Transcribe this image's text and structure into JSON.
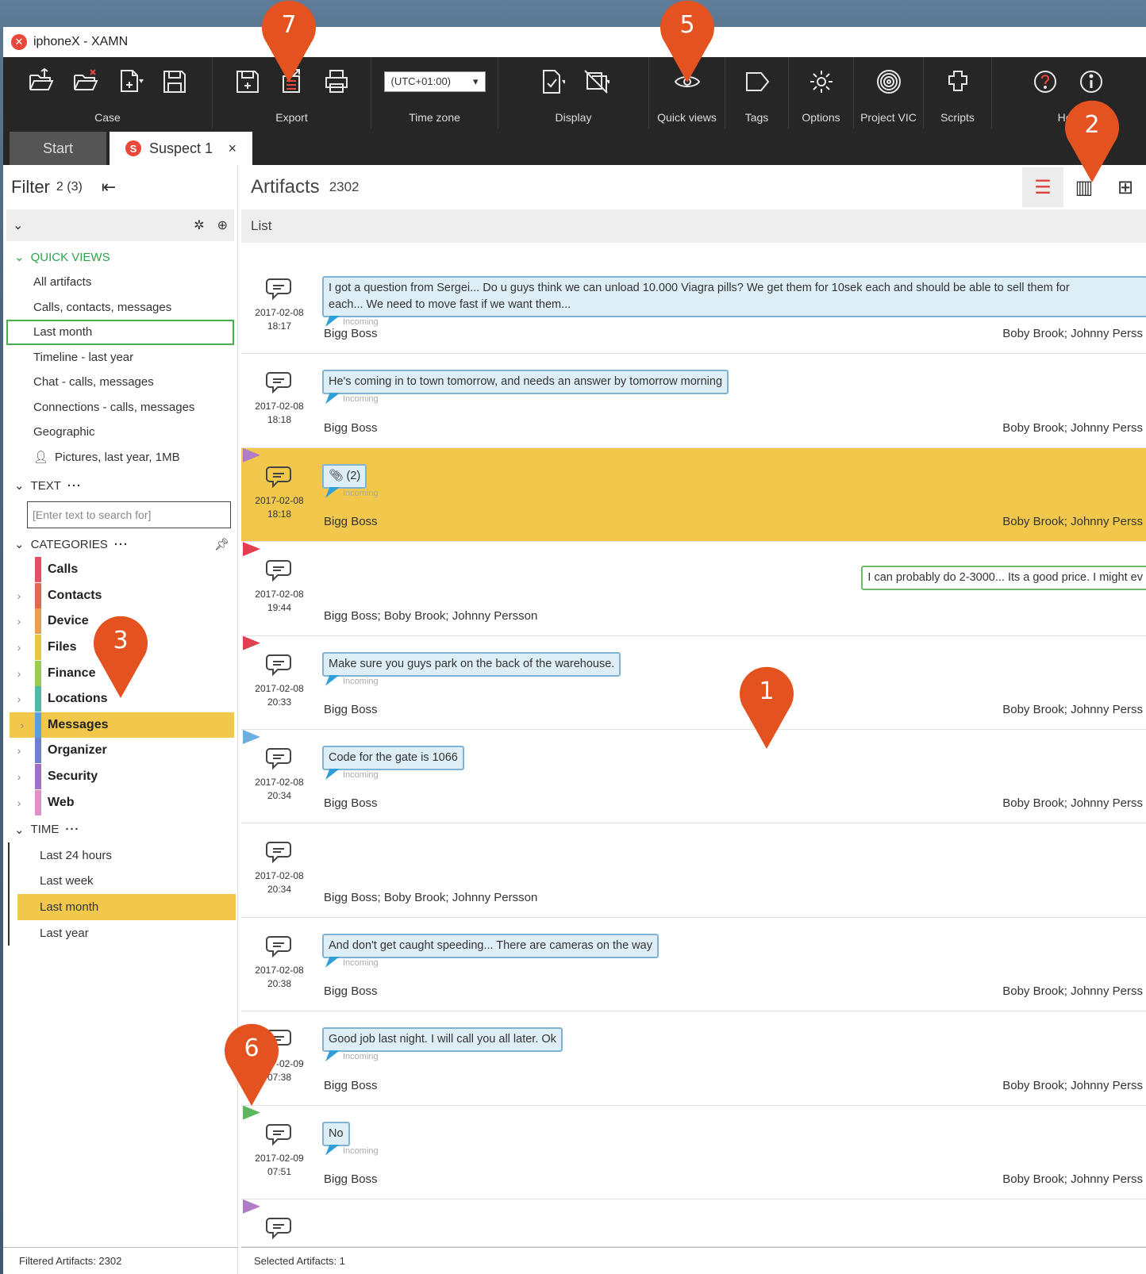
{
  "window": {
    "title": "iphoneX - XAMN",
    "logo_glyph": "✕"
  },
  "toolbar": {
    "groups": [
      {
        "label": "Case",
        "icons": [
          "open-case-icon",
          "close-case-icon",
          "new-case-icon",
          "save-icon"
        ]
      },
      {
        "label": "Export",
        "icons": [
          "save-export-icon",
          "export-icon",
          "print-icon"
        ]
      },
      {
        "label": "Time zone",
        "select_value": "(UTC+01:00)"
      },
      {
        "label": "Display",
        "icons": [
          "document-check-icon",
          "display-settings-icon"
        ]
      },
      {
        "label": "Quick views",
        "icons": [
          "eye-icon"
        ]
      },
      {
        "label": "Tags",
        "icons": [
          "tag-icon"
        ]
      },
      {
        "label": "Options",
        "icons": [
          "gear-icon"
        ]
      },
      {
        "label": "Project VIC",
        "icons": [
          "fingerprint-icon"
        ]
      },
      {
        "label": "Scripts",
        "icons": [
          "puzzle-icon"
        ]
      },
      {
        "label": "Help",
        "icons": [
          "help-icon",
          "info-icon"
        ]
      }
    ]
  },
  "tabs": {
    "start": "Start",
    "suspect": "Suspect 1",
    "suspect_badge": "S",
    "close": "×"
  },
  "filter": {
    "title": "Filter",
    "count": "2 (3)",
    "quick_views_label": "QUICK VIEWS",
    "quick_views": [
      "All artifacts",
      "Calls, contacts, messages",
      "Last month",
      "Timeline - last year",
      "Chat - calls, messages",
      "Connections - calls, messages",
      "Geographic",
      "Pictures, last year, 1MB"
    ],
    "text_label": "TEXT",
    "text_placeholder": "[Enter text to search for]",
    "categories_label": "CATEGORIES",
    "categories": [
      {
        "name": "Calls",
        "color": "#e4506a"
      },
      {
        "name": "Contacts",
        "color": "#e06850"
      },
      {
        "name": "Device",
        "color": "#e8a050"
      },
      {
        "name": "Files",
        "color": "#e8c840"
      },
      {
        "name": "Finance",
        "color": "#9acd50"
      },
      {
        "name": "Locations",
        "color": "#50b8a8"
      },
      {
        "name": "Messages",
        "color": "#5aa0e0"
      },
      {
        "name": "Organizer",
        "color": "#7080d0"
      },
      {
        "name": "Security",
        "color": "#a070c8"
      },
      {
        "name": "Web",
        "color": "#e090c8"
      }
    ],
    "time_label": "TIME",
    "time_items": [
      "Last 24 hours",
      "Last week",
      "Last month",
      "Last year"
    ],
    "footer": "Filtered Artifacts: 2302"
  },
  "artifacts": {
    "title": "Artifacts",
    "count": "2302",
    "list_label": "List",
    "footer": "Selected Artifacts: 1",
    "incoming_label": "Incoming",
    "rows": [
      {
        "date": "2017-02-08",
        "time": "18:17",
        "message": "I got a question from Sergei... Do u guys think we can unload 10.000 Viagra pills? We get them for 10sek each and should be able to sell them for",
        "message2": "each... We need to move fast if we want them...",
        "from": "Bigg Boss",
        "to": "Boby Brook; Johnny Perss",
        "flag": ""
      },
      {
        "date": "2017-02-08",
        "time": "18:18",
        "message": "He's coming in to town tomorrow, and needs an answer by tomorrow morning",
        "from": "Bigg Boss",
        "to": "Boby Brook; Johnny Perss",
        "flag": ""
      },
      {
        "date": "2017-02-08",
        "time": "18:18",
        "message": "(2)",
        "from": "Bigg Boss",
        "to": "Boby Brook; Johnny Perss",
        "flag": "#b07cc8"
      },
      {
        "date": "2017-02-08",
        "time": "19:44",
        "message": "I can probably do 2-3000... Its a good price. I might ev",
        "from": "Bigg Boss; Boby Brook; Johnny Persson",
        "to": "",
        "flag": "#e04050"
      },
      {
        "date": "2017-02-08",
        "time": "20:33",
        "message": "Make sure you guys park on the back of the warehouse.",
        "from": "Bigg Boss",
        "to": "Boby Brook; Johnny Perss",
        "flag": "#e04050"
      },
      {
        "date": "2017-02-08",
        "time": "20:34",
        "message": "Code for the gate is 1066",
        "from": "Bigg Boss",
        "to": "Boby Brook; Johnny Perss",
        "flag": "#6ab0e0"
      },
      {
        "date": "2017-02-08",
        "time": "20:34",
        "message": "",
        "from": "Bigg Boss; Boby Brook; Johnny Persson",
        "to": "",
        "flag": ""
      },
      {
        "date": "2017-02-08",
        "time": "20:38",
        "message": "And don't get caught speeding... There are cameras on the way",
        "from": "Bigg Boss",
        "to": "Boby Brook; Johnny Perss",
        "flag": ""
      },
      {
        "date": "2017-02-09",
        "time": "07:38",
        "message": "Good job last night. I will call you all later. Ok",
        "from": "Bigg Boss",
        "to": "Boby Brook; Johnny Perss",
        "flag": ""
      },
      {
        "date": "2017-02-09",
        "time": "07:51",
        "message": "No",
        "from": "Bigg Boss",
        "to": "Boby Brook; Johnny Perss",
        "flag": "#5cb85c"
      }
    ]
  },
  "markers": [
    "7",
    "5",
    "2",
    "3",
    "1",
    "6"
  ],
  "colors": {
    "highlight": "#f1c84b",
    "marker": "#e4521f",
    "quick_views_green": "#2fa14a"
  }
}
